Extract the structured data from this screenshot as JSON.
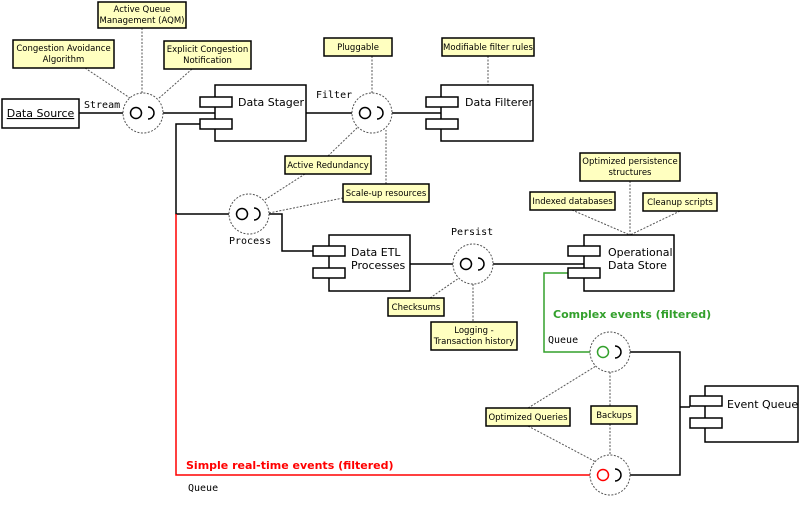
{
  "components": {
    "data_source": "Data Source",
    "data_stager": "Data Stager",
    "data_filterer": "Data Filterer",
    "data_etl": [
      "Data ETL",
      "Processes"
    ],
    "ods": [
      "Operational",
      "Data Store"
    ],
    "event_queue": "Event Queue"
  },
  "interfaces": {
    "stream": "Stream",
    "filter": "Filter",
    "process": "Process",
    "persist": "Persist",
    "queue_complex": "Queue",
    "queue_simple": "Queue"
  },
  "notes": {
    "aqm": [
      "Active Queue",
      "Management (AQM)"
    ],
    "congestion_avoidance": [
      "Congestion Avoidance",
      "Algorithm"
    ],
    "ecn": [
      "Explicit Congestion",
      "Notification"
    ],
    "pluggable": [
      "Pluggable"
    ],
    "modifiable": [
      "Modifiable filter rules"
    ],
    "active_redundancy": [
      "Active Redundancy"
    ],
    "scale_up": [
      "Scale-up resources"
    ],
    "opt_persistence": [
      "Optimized persistence",
      "structures"
    ],
    "indexed_db": [
      "Indexed databases"
    ],
    "cleanup": [
      "Cleanup scripts"
    ],
    "checksums": [
      "Checksums"
    ],
    "logging": [
      "Logging -",
      "Transaction history"
    ],
    "opt_queries": [
      "Optimized Queries"
    ],
    "backups": [
      "Backups"
    ]
  },
  "flows": {
    "complex": {
      "label": "Complex events (filtered)",
      "color": "#33a02c"
    },
    "simple": {
      "label": "Simple real-time events (filtered)",
      "color": "#ff0000"
    }
  }
}
